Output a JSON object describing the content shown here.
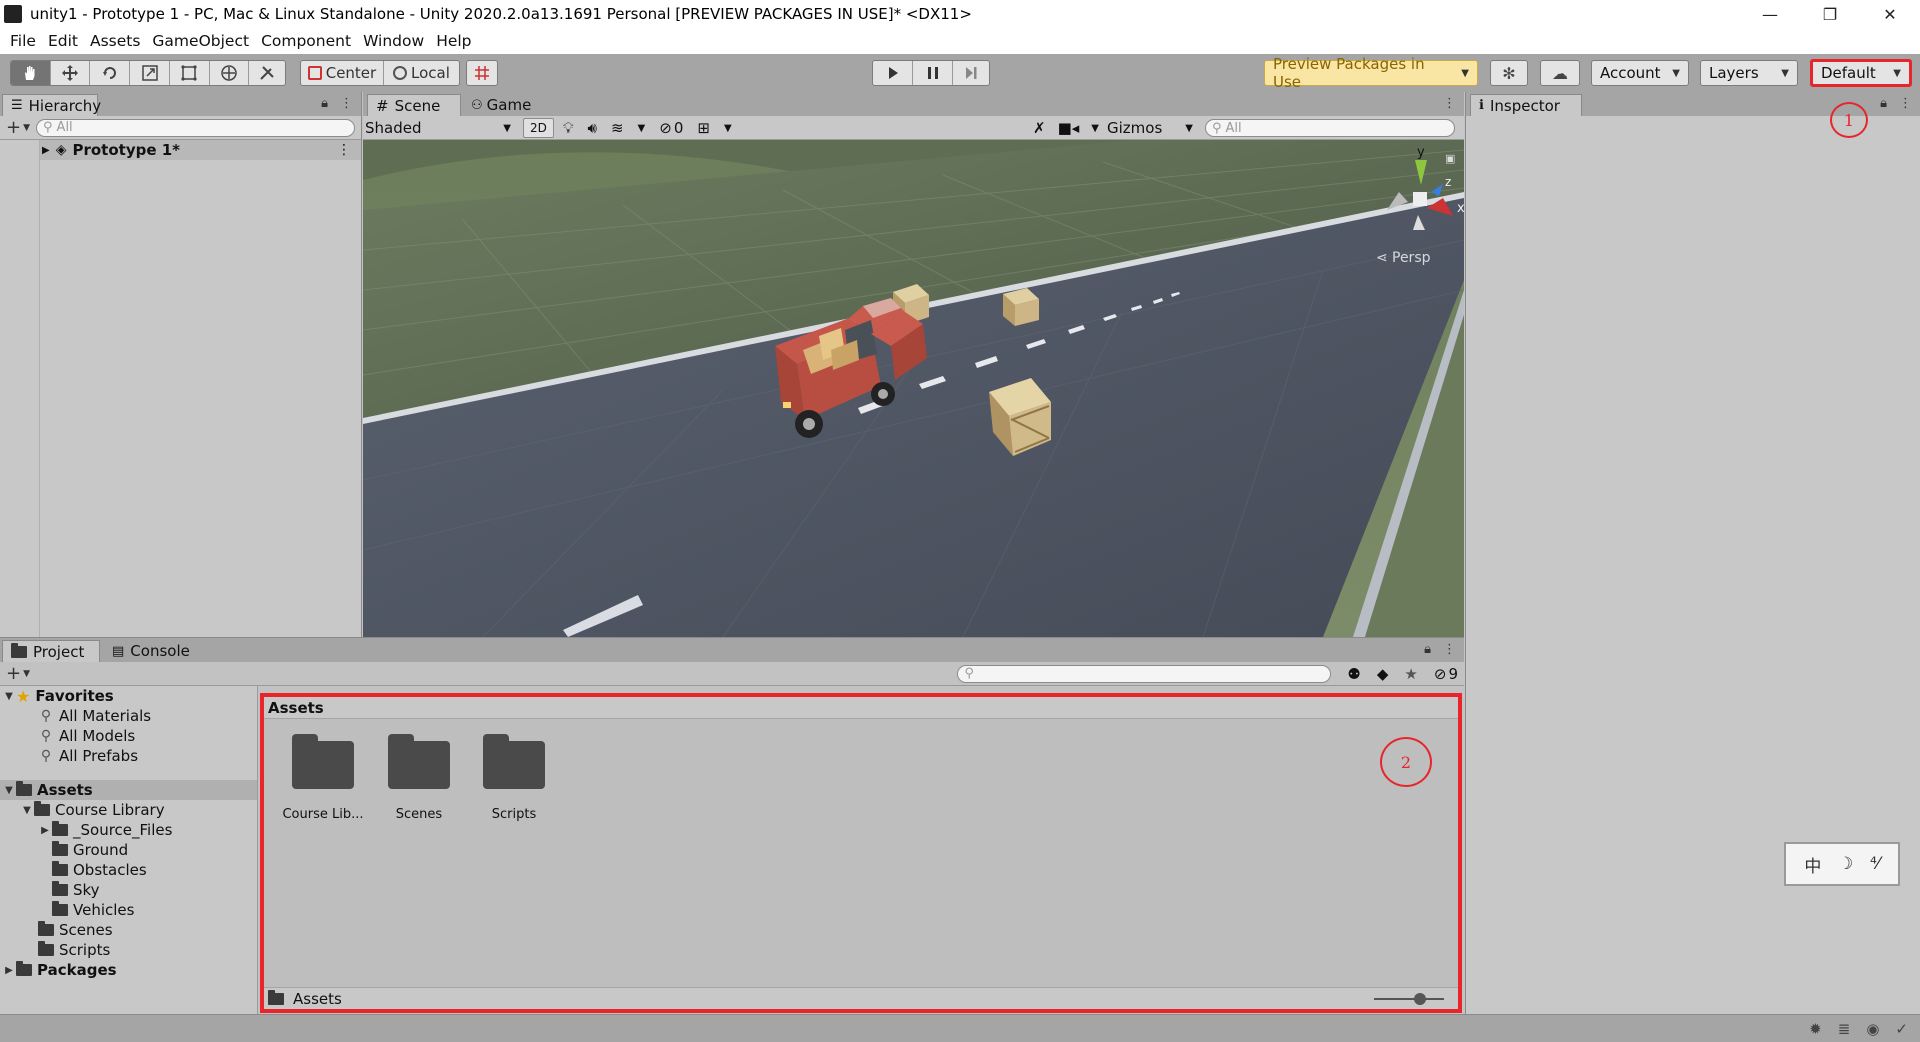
{
  "window": {
    "title": "unity1 - Prototype 1 - PC, Mac & Linux Standalone - Unity 2020.2.0a13.1691 Personal [PREVIEW PACKAGES IN USE]* <DX11>",
    "minimize": "—",
    "maximize": "❐",
    "close": "✕"
  },
  "menu": [
    "File",
    "Edit",
    "Assets",
    "GameObject",
    "Component",
    "Window",
    "Help"
  ],
  "toolbar": {
    "pivot_center": "Center",
    "pivot_local": "Local",
    "preview_packages": "Preview Packages in Use",
    "account": "Account",
    "layers": "Layers",
    "layout": "Default"
  },
  "hierarchy": {
    "tab": "Hierarchy",
    "search_placeholder": "All",
    "scene_item": "Prototype 1*"
  },
  "scene": {
    "tab_scene": "Scene",
    "tab_game": "Game",
    "shading": "Shaded",
    "mode_2d": "2D",
    "hidden_count": "0",
    "gizmos": "Gizmos",
    "search_placeholder": "All",
    "persp": "Persp",
    "axis_y": "y",
    "axis_x": "x",
    "axis_z": "z"
  },
  "project": {
    "tab_project": "Project",
    "tab_console": "Console",
    "hidden_packages_count": "9",
    "favorites_label": "Favorites",
    "favorites": [
      "All Materials",
      "All Models",
      "All Prefabs"
    ],
    "assets_label": "Assets",
    "tree": {
      "course_library": "Course Library",
      "course_children": [
        "_Source_Files",
        "Ground",
        "Obstacles",
        "Sky",
        "Vehicles"
      ],
      "scenes": "Scenes",
      "scripts": "Scripts",
      "packages": "Packages"
    },
    "grid_header": "Assets",
    "grid_items": [
      "Course Lib...",
      "Scenes",
      "Scripts"
    ],
    "footer_path": "Assets"
  },
  "inspector": {
    "tab": "Inspector"
  },
  "annotations": {
    "one": "1",
    "two": "2"
  },
  "ime": [
    "中",
    "☽",
    "⁴⁄"
  ],
  "colors": {
    "highlight_red": "#e8252a",
    "preview_yellow": "#f9e6a5",
    "toolbar_bg": "#a5a5a5",
    "panel_bg": "#c8c8c8"
  }
}
